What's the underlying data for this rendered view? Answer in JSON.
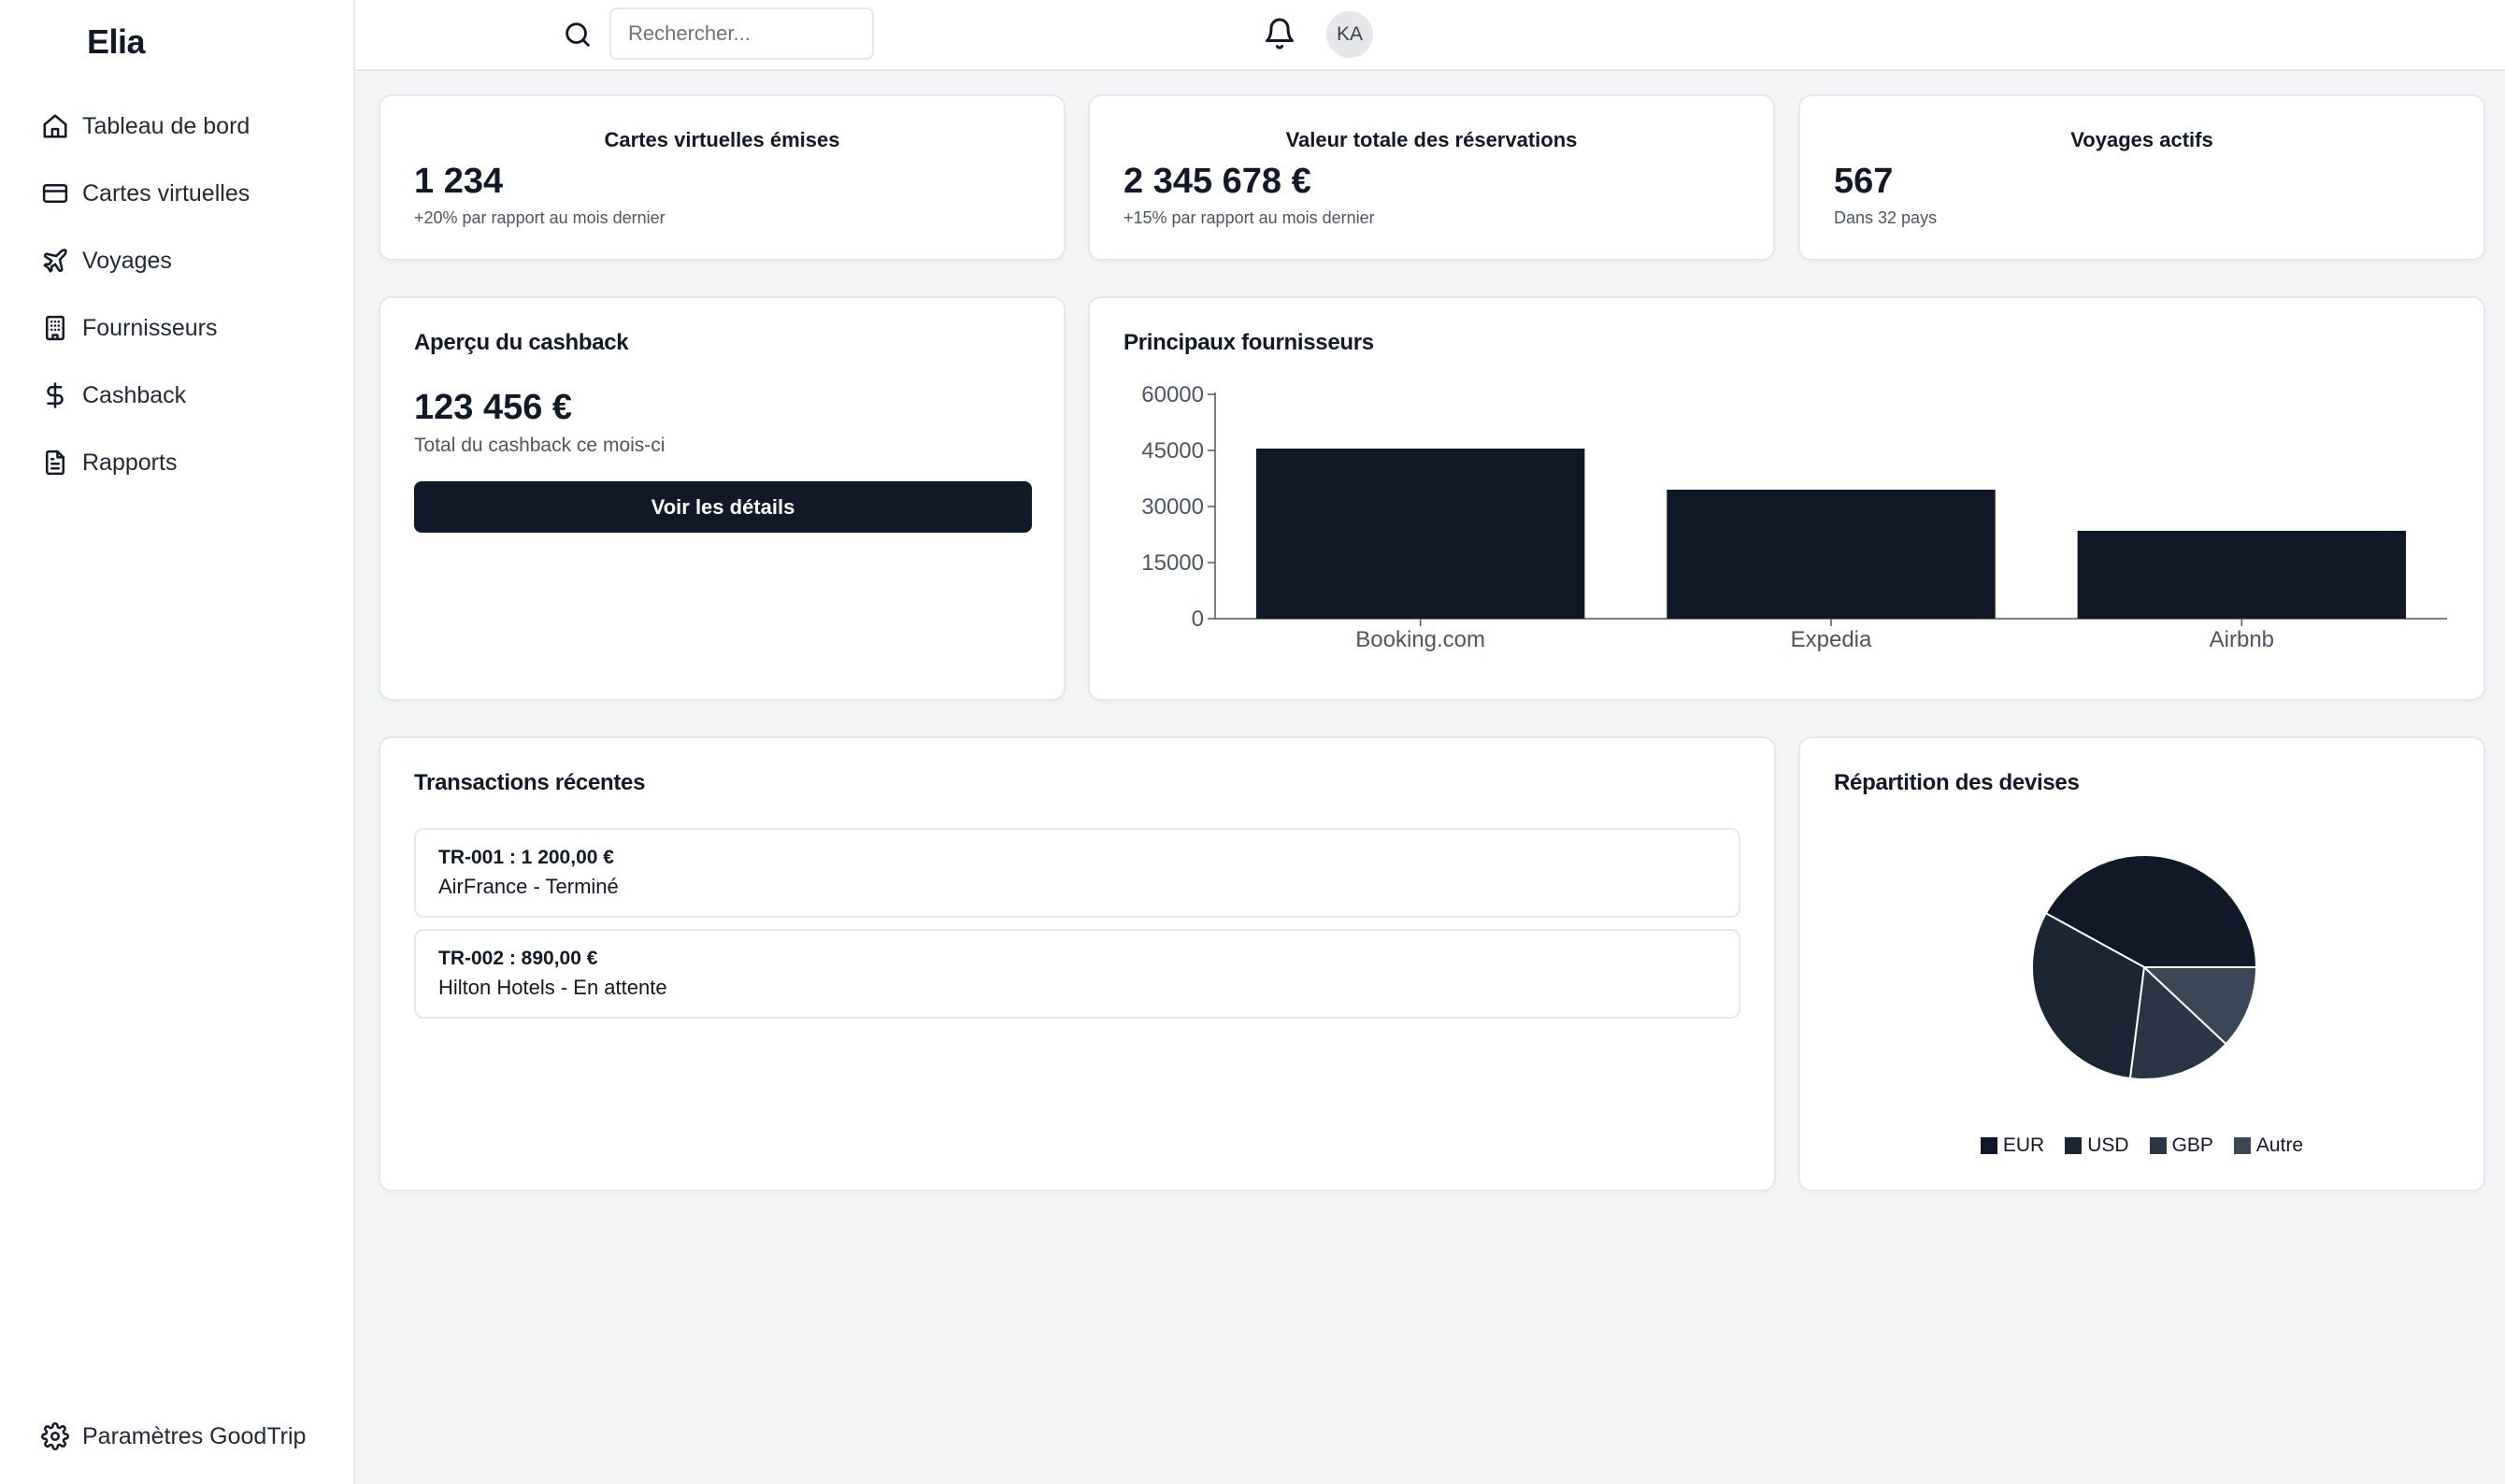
{
  "app": {
    "brand": "Elia"
  },
  "sidebar": {
    "items": [
      {
        "label": "Tableau de bord",
        "icon": "home-icon"
      },
      {
        "label": "Cartes virtuelles",
        "icon": "credit-card-icon"
      },
      {
        "label": "Voyages",
        "icon": "plane-icon"
      },
      {
        "label": "Fournisseurs",
        "icon": "building-icon"
      },
      {
        "label": "Cashback",
        "icon": "dollar-icon"
      },
      {
        "label": "Rapports",
        "icon": "file-text-icon"
      }
    ],
    "settings": {
      "label": "Paramètres GoodTrip",
      "icon": "gear-icon"
    }
  },
  "header": {
    "search": {
      "placeholder": "Rechercher...",
      "value": ""
    },
    "avatar_initials": "KA"
  },
  "stats": [
    {
      "title": "Cartes virtuelles émises",
      "value": "1 234",
      "sub": "+20% par rapport au mois dernier"
    },
    {
      "title": "Valeur totale des réservations",
      "value": "2 345 678 €",
      "sub": "+15% par rapport au mois dernier"
    },
    {
      "title": "Voyages actifs",
      "value": "567",
      "sub": "Dans 32 pays"
    }
  ],
  "cashback": {
    "title": "Aperçu du cashback",
    "value": "123 456 €",
    "sub": "Total du cashback ce mois-ci",
    "button": "Voir les détails"
  },
  "suppliers": {
    "title": "Principaux fournisseurs"
  },
  "transactions": {
    "title": "Transactions récentes",
    "items": [
      {
        "line1": "TR-001 : 1 200,00 €",
        "line2": "AirFrance - Terminé"
      },
      {
        "line1": "TR-002 : 890,00 €",
        "line2": "Hilton Hotels - En attente"
      }
    ]
  },
  "currencies": {
    "title": "Répartition des devises"
  },
  "colors": {
    "primary": "#111827",
    "usd": "#1c2533",
    "gbp": "#2b3545",
    "autre": "#3b4658",
    "border": "#e5e7eb",
    "background": "#f3f4f6"
  },
  "chart_data": [
    {
      "type": "bar",
      "categories": [
        "Booking.com",
        "Expedia",
        "Airbnb"
      ],
      "values": [
        45500,
        34500,
        23500
      ],
      "yticks": [
        0,
        15000,
        30000,
        45000,
        60000
      ],
      "ylim": [
        0,
        60000
      ],
      "grid": false
    },
    {
      "type": "pie",
      "labels": [
        "EUR",
        "USD",
        "GBP",
        "Autre"
      ],
      "values": [
        42,
        31,
        15,
        12
      ],
      "legend_position": "bottom"
    }
  ]
}
